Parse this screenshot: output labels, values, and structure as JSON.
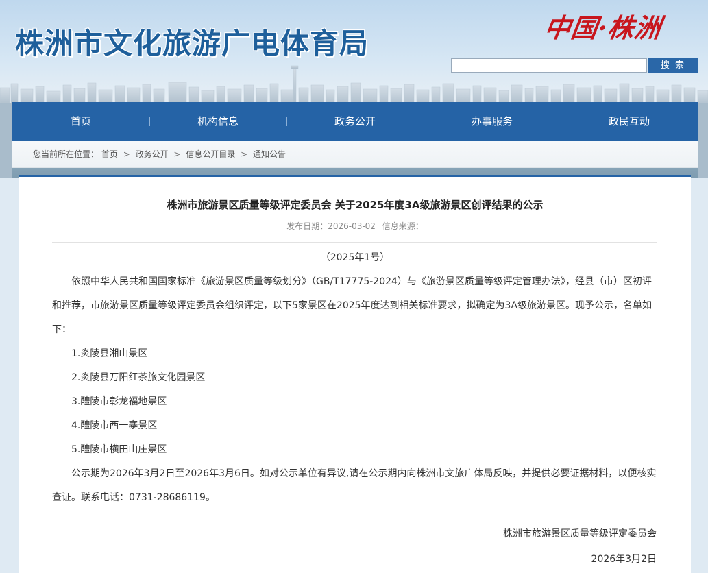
{
  "header": {
    "site_title": "株洲市文化旅游广电体育局",
    "logo_text": "中国·株洲",
    "search": {
      "value": "",
      "button_label": "搜 索"
    }
  },
  "nav": {
    "items": [
      "首页",
      "机构信息",
      "政务公开",
      "办事服务",
      "政民互动"
    ]
  },
  "breadcrumb": {
    "label": "您当前所在位置：",
    "items": [
      "首页",
      "政务公开",
      "信息公开目录",
      "通知公告"
    ],
    "separator": ">"
  },
  "article": {
    "title": "株洲市旅游景区质量等级评定委员会 关于2025年度3A级旅游景区创评结果的公示",
    "publish_date_label": "发布日期：2026-03-02",
    "source_label": "信息来源：",
    "doc_number": "（2025年1号）",
    "intro": "依照中华人民共和国国家标准《旅游景区质量等级划分》（GB/T17775-2024）与《旅游景区质量等级评定管理办法》，经县（市）区初评和推荐，市旅游景区质量等级评定委员会组织评定，以下5家景区在2025年度达到相关标准要求，拟确定为3A级旅游景区。现予公示，名单如下：",
    "list": [
      "1.炎陵县湘山景区",
      "2.炎陵县万阳红茶旅文化园景区",
      "3.醴陵市彰龙福地景区",
      "4.醴陵市西一寨景区",
      "5.醴陵市横田山庄景区"
    ],
    "notice": "公示期为2026年3月2日至2026年3月6日。如对公示单位有异议,请在公示期内向株洲市文旅广体局反映，并提供必要证据材料，以便核实查证。联系电话：0731-28686119。",
    "signature": "株洲市旅游景区质量等级评定委员会",
    "sign_date": "2026年3月2日"
  },
  "colors": {
    "brand_blue": "#2563a6",
    "title_blue": "#1e5f9b",
    "logo_red": "#c8161d"
  }
}
